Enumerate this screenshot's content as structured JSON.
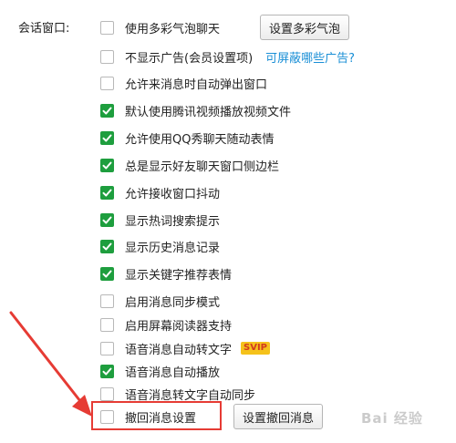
{
  "section": {
    "label": "会话窗口:"
  },
  "options": [
    {
      "label": "使用多彩气泡聊天",
      "checked": false
    },
    {
      "label": "不显示广告(会员设置项)",
      "checked": false
    },
    {
      "label": "允许来消息时自动弹出窗口",
      "checked": false
    },
    {
      "label": "默认使用腾讯视频播放视频文件",
      "checked": true
    },
    {
      "label": "允许使用QQ秀聊天随动表情",
      "checked": true
    },
    {
      "label": "总是显示好友聊天窗口侧边栏",
      "checked": true
    },
    {
      "label": "允许接收窗口抖动",
      "checked": true
    },
    {
      "label": "显示热词搜索提示",
      "checked": true
    },
    {
      "label": "显示历史消息记录",
      "checked": true
    },
    {
      "label": "显示关键字推荐表情",
      "checked": true
    },
    {
      "label": "启用消息同步模式",
      "checked": false
    },
    {
      "label": "启用屏幕阅读器支持",
      "checked": false
    },
    {
      "label": "语音消息自动转文字",
      "checked": false
    },
    {
      "label": "语音消息自动播放",
      "checked": true
    },
    {
      "label": "语音消息转文字自动同步",
      "checked": false
    },
    {
      "label": "撤回消息设置",
      "checked": false
    }
  ],
  "buttons": {
    "bubble": "设置多彩气泡",
    "recall": "设置撤回消息"
  },
  "link": {
    "ads": "可屏蔽哪些广告?"
  },
  "badge": {
    "svip": "SVIP"
  },
  "watermark": {
    "text": "Bai 经验"
  },
  "colors": {
    "check": "#1e9e3e",
    "link": "#1a8fd6",
    "annotation": "#e63b34",
    "badge": "#f5c21b"
  }
}
